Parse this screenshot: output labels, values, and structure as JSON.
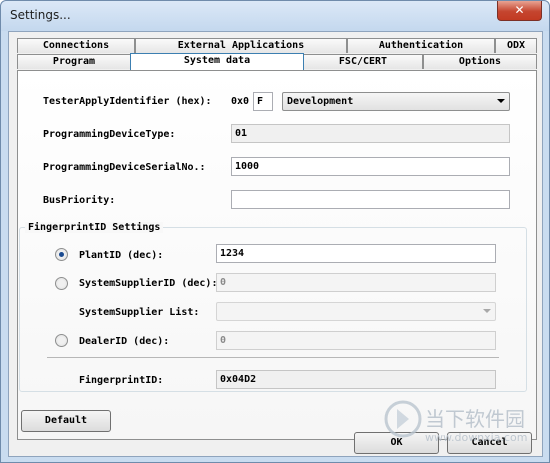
{
  "window": {
    "title": "Settings...",
    "close_glyph": "✕"
  },
  "tabs": {
    "row_back": [
      "Connections",
      "External Applications",
      "Authentication",
      "ODX"
    ],
    "row_front": [
      "Program",
      "System data",
      "FSC/CERT",
      "Options"
    ],
    "active": "System data"
  },
  "system_data": {
    "tester_apply_identifier": {
      "label": "TesterApplyIdentifier (hex):",
      "prefix": "0x0",
      "value": "F",
      "mode_options_selected": "Development"
    },
    "programming_device_type": {
      "label": "ProgrammingDeviceType:",
      "value": "01"
    },
    "programming_device_serial": {
      "label": "ProgrammingDeviceSerialNo.:",
      "value": "1000"
    },
    "bus_priority": {
      "label": "BusPriority:",
      "value": ""
    }
  },
  "fingerprint": {
    "group_title": "FingerprintID Settings",
    "plant_id": {
      "label": "PlantID (dec):",
      "value": "1234",
      "checked": true
    },
    "system_supplier_id": {
      "label": "SystemSupplierID (dec):",
      "value": "0",
      "checked": false
    },
    "system_supplier_list": {
      "label": "SystemSupplier List:",
      "value": ""
    },
    "dealer_id": {
      "label": "DealerID (dec):",
      "value": "0",
      "checked": false
    },
    "fingerprint_id": {
      "label": "FingerprintID:",
      "value": "0x04D2"
    }
  },
  "buttons": {
    "default": "Default",
    "ok": "OK",
    "cancel": "Cancel"
  },
  "watermark": {
    "text_cn": "当下软件园",
    "url": "www.downxia.com"
  },
  "colors": {
    "radio_selected": "#1a4a90",
    "title_bar": "#c9dcf0",
    "close_button": "#c5452f"
  }
}
